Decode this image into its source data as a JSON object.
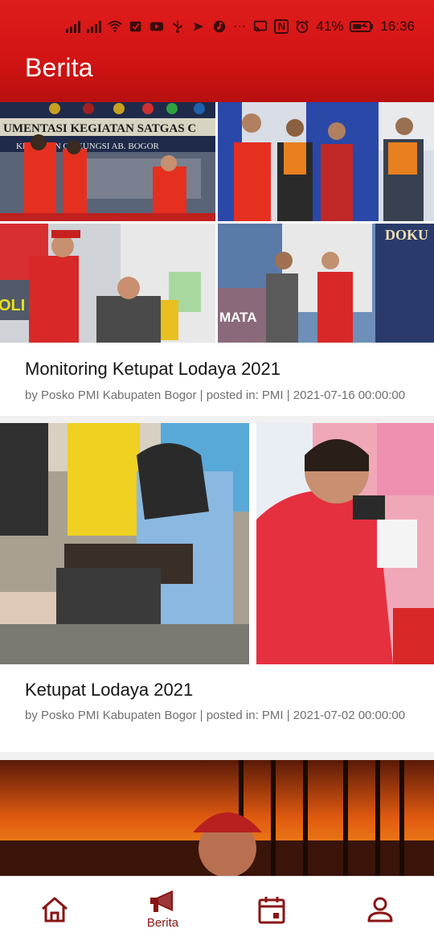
{
  "status_bar": {
    "battery": "41%",
    "time": "16:36",
    "overflow": "···",
    "nfc": "N"
  },
  "app_bar": {
    "title": "Berita"
  },
  "articles": [
    {
      "title": "Monitoring Ketupat Lodaya 2021",
      "meta": "by Posko PMI Kabupaten Bogor |  posted in: PMI |  2021-07-16 00:00:00",
      "image_texts": {
        "banner_1": "UMENTASI KEGIATAN SATGAS C",
        "banner_2": "KE  MATAN CILEUNGSI  AB. BOGOR",
        "police_van": "OLI",
        "building": "MATA",
        "banner_3": "DOKU"
      }
    },
    {
      "title": "Ketupat Lodaya 2021",
      "meta": "by Posko PMI Kabupaten Bogor |  posted in: PMI |  2021-07-02 00:00:00"
    },
    {
      "title": "",
      "meta": ""
    }
  ],
  "bottom_nav": {
    "items": [
      {
        "icon": "home-icon",
        "label": ""
      },
      {
        "icon": "megaphone-icon",
        "label": "Berita"
      },
      {
        "icon": "calendar-icon",
        "label": ""
      },
      {
        "icon": "profile-icon",
        "label": ""
      }
    ]
  },
  "colors": {
    "primary": "#d11414",
    "nav_active": "#8a1414"
  }
}
